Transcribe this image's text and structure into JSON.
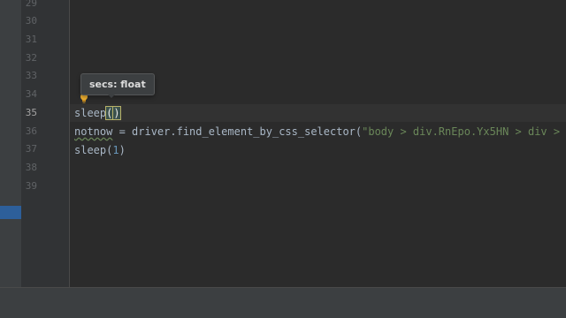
{
  "editor": {
    "line_numbers": [
      "29",
      "30",
      "31",
      "32",
      "33",
      "34",
      "35",
      "36",
      "37",
      "38",
      "39"
    ],
    "current_line": "35",
    "tooltip": "secs: float",
    "code": {
      "line35": {
        "func": "sleep",
        "open": "(",
        "close": ")"
      },
      "line36": {
        "var": "notnow",
        "mid": " = driver.find_element_by_css_selector(",
        "str": "\"body > div.RnEpo.Yx5HN > div >"
      },
      "line37": {
        "func": "sleep(",
        "num": "1",
        "close": ")"
      }
    }
  },
  "colors": {
    "background": "#2b2b2b",
    "gutter": "#313335",
    "string": "#6a8759",
    "number": "#6897bb",
    "identifier": "#a9b7c6"
  },
  "icons": [
    "lightbulb-icon"
  ]
}
